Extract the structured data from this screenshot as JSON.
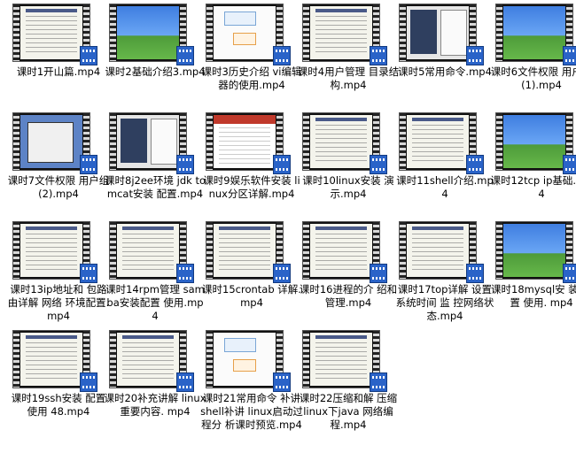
{
  "files": [
    {
      "name": "课时1开山篇.mp4",
      "thumb": "doc"
    },
    {
      "name": "课时2基础介绍3.mp4",
      "thumb": "sky"
    },
    {
      "name": "课时3历史介绍 vi编辑器的使用.mp4",
      "thumb": "white"
    },
    {
      "name": "课时4用户管理 目录结构.mp4",
      "thumb": "doc"
    },
    {
      "name": "课时5常用命令.mp4",
      "thumb": "mixed"
    },
    {
      "name": "课时6文件权限 用户组(1).mp4",
      "thumb": "sky"
    },
    {
      "name": "课时7文件权限 用户组(2).mp4",
      "thumb": "dialog"
    },
    {
      "name": "课时8j2ee环境 jdk tomcat安装 配置.mp4",
      "thumb": "mixed"
    },
    {
      "name": "课时9娱乐软件安装 linux分区详解.mp4",
      "thumb": "web"
    },
    {
      "name": "课时10linux安装 演示.mp4",
      "thumb": "doc"
    },
    {
      "name": "课时11shell介绍.mp4",
      "thumb": "doc"
    },
    {
      "name": "课时12tcp ip基础.mp4",
      "thumb": "sky"
    },
    {
      "name": "课时13ip地址和 包路由详解 网络 环境配置.mp4",
      "thumb": "doc"
    },
    {
      "name": "课时14rpm管理 samba安装配置 使用.mp4",
      "thumb": "doc"
    },
    {
      "name": "课时15crontab 详解.mp4",
      "thumb": "doc"
    },
    {
      "name": "课时16进程的介 绍和管理.mp4",
      "thumb": "doc"
    },
    {
      "name": "课时17top详解 设置系统时间 监 控网络状态.mp4",
      "thumb": "doc"
    },
    {
      "name": "课时18mysql安 装 配置 使用. mp4",
      "thumb": "sky"
    },
    {
      "name": "课时19ssh安装 配置 使用 48.mp4",
      "thumb": "doc"
    },
    {
      "name": "课时20补充讲解 linux重要内容. mp4",
      "thumb": "doc"
    },
    {
      "name": "课时21常用命令 补讲 shell补讲 linux启动过程分 析课时预览.mp4",
      "thumb": "white"
    },
    {
      "name": "课时22压缩和解 压缩 linux下java 网络编程.mp4",
      "thumb": "doc"
    }
  ]
}
